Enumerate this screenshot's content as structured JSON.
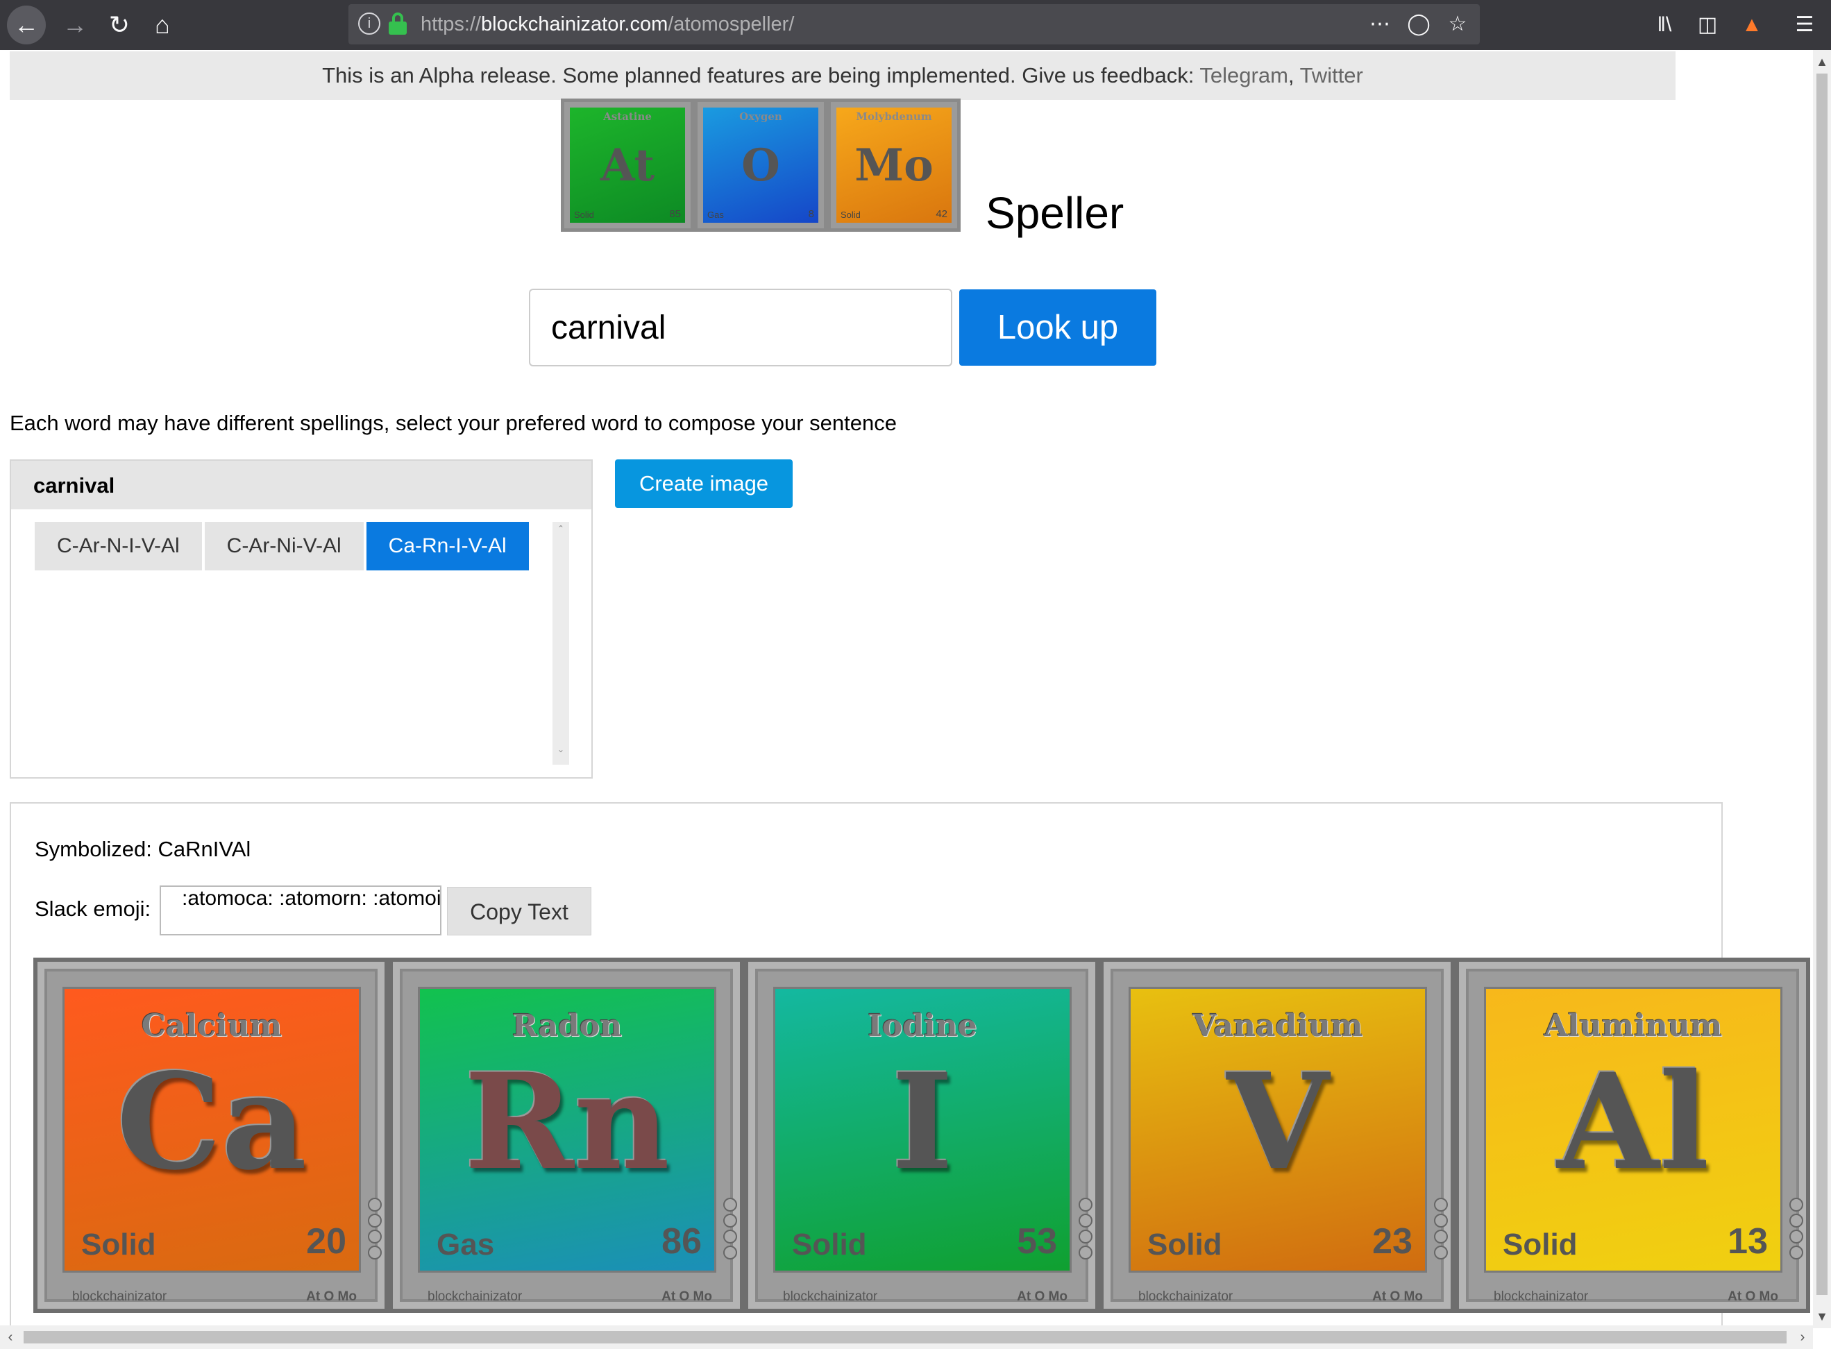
{
  "browser": {
    "url_scheme": "https://",
    "url_host": "blockchainizator.com",
    "url_path": "/atomospeller/",
    "icons": [
      "back-icon",
      "forward-icon",
      "reload-icon",
      "home-icon",
      "info-icon",
      "lock-icon",
      "more-icon",
      "pocket-icon",
      "bookmark-star-icon",
      "library-icon",
      "sidebar-icon",
      "extension-icon",
      "menu-icon"
    ]
  },
  "banner": {
    "text": "This is an Alpha release. Some planned features are being implemented. Give us feedback: ",
    "link1": "Telegram",
    "sep": ", ",
    "link2": "Twitter"
  },
  "logo": {
    "tiles": [
      {
        "name": "Astatine",
        "symbol": "At",
        "phase": "Solid",
        "number": "85",
        "color1": "#1db52b",
        "color2": "#0d8a24"
      },
      {
        "name": "Oxygen",
        "symbol": "O",
        "phase": "Gas",
        "number": "8",
        "color1": "#1a9be0",
        "color2": "#1546c8"
      },
      {
        "name": "Molybdenum",
        "symbol": "Mo",
        "phase": "Solid",
        "number": "42",
        "color1": "#f7a81b",
        "color2": "#d9760e"
      }
    ],
    "title": "Speller"
  },
  "search": {
    "value": "carnival",
    "button": "Look up"
  },
  "instructions": "Each word may have different spellings, select your prefered word to compose your sentence",
  "word_panel": {
    "word": "carnival",
    "options": [
      "C-Ar-N-I-V-Al",
      "C-Ar-Ni-V-Al",
      "Ca-Rn-I-V-Al"
    ],
    "selected": "Ca-Rn-I-V-Al"
  },
  "create_button": "Create image",
  "result": {
    "symbolized": "Symbolized: CaRnIVAl",
    "slack_label": "Slack emoji:",
    "slack_value": ":atomoca: :atomorn: :atomoi: :atomov: :atomoal:",
    "copy_button": "Copy Text"
  },
  "elements": [
    {
      "name": "Calcium",
      "symbol": "Ca",
      "phase": "Solid",
      "number": "20",
      "color1": "#ff5a1e",
      "color2": "#d96a10"
    },
    {
      "name": "Radon",
      "symbol": "Rn",
      "phase": "Gas",
      "number": "86",
      "color1": "#12c24e",
      "color2": "#1b8fb8"
    },
    {
      "name": "Iodine",
      "symbol": "I",
      "phase": "Solid",
      "number": "53",
      "color1": "#14b8a0",
      "color2": "#10a030"
    },
    {
      "name": "Vanadium",
      "symbol": "V",
      "phase": "Solid",
      "number": "23",
      "color1": "#e8c010",
      "color2": "#d06c10"
    },
    {
      "name": "Aluminum",
      "symbol": "Al",
      "phase": "Solid",
      "number": "13",
      "color1": "#f7b81b",
      "color2": "#f0d010"
    }
  ],
  "tile_footer": {
    "left": "blockchainizator",
    "right": "At O Mo"
  }
}
